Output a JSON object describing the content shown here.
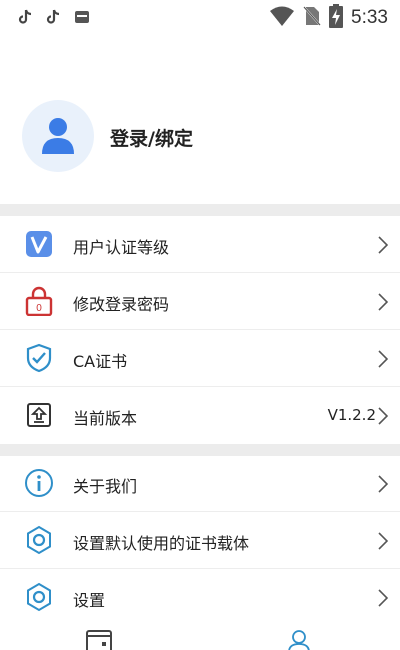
{
  "status_bar": {
    "time": "5:33",
    "notification_icons": [
      "tiktok-icon",
      "tiktok-icon",
      "message-icon"
    ],
    "system_icons": [
      "wifi-icon",
      "no-sim-icon",
      "battery-charging-icon"
    ]
  },
  "profile": {
    "login_label": "登录/绑定",
    "avatar_color": "#3b7ce6"
  },
  "menu_group_1": [
    {
      "label": "用户认证等级",
      "icon": "verify-level-icon"
    },
    {
      "label": "修改登录密码",
      "icon": "password-lock-icon"
    },
    {
      "label": "CA证书",
      "icon": "shield-check-icon"
    },
    {
      "label": "当前版本",
      "icon": "version-upgrade-icon",
      "value": "V1.2.2"
    }
  ],
  "menu_group_2": [
    {
      "label": "关于我们",
      "icon": "info-icon"
    },
    {
      "label": "设置默认使用的证书载体",
      "icon": "gear-icon"
    },
    {
      "label": "设置",
      "icon": "gear-icon"
    }
  ],
  "bottom_nav": {
    "items": [
      "home-tab-icon",
      "me-tab-icon"
    ],
    "active_color": "#2f8fc9"
  }
}
